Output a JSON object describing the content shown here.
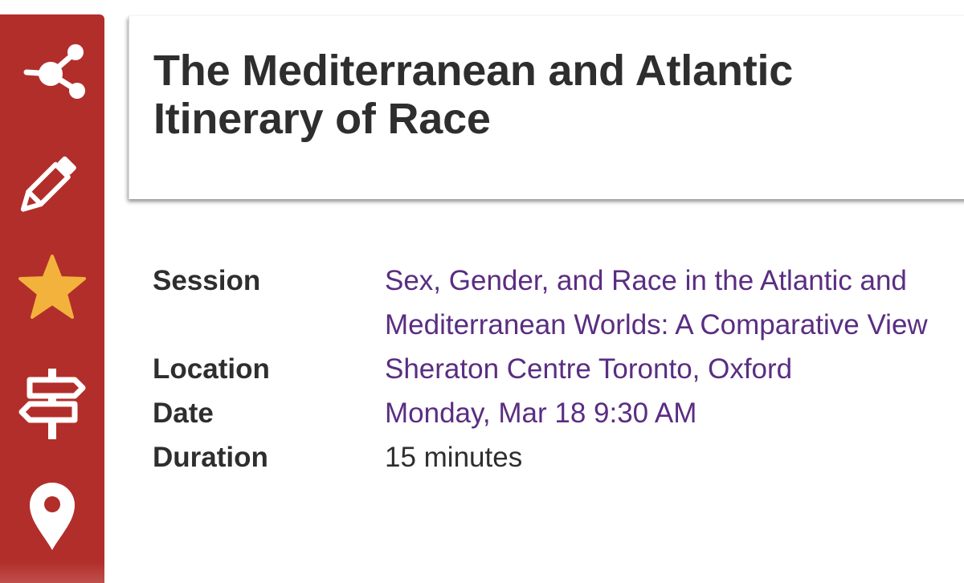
{
  "toolbar": {
    "items": [
      {
        "name": "share",
        "icon": "share-icon"
      },
      {
        "name": "edit",
        "icon": "pencil-icon"
      },
      {
        "name": "favorite",
        "icon": "star-icon"
      },
      {
        "name": "directions",
        "icon": "signpost-icon"
      },
      {
        "name": "location",
        "icon": "map-pin-icon"
      }
    ],
    "color": "#b22e2b",
    "star_color": "#f3b23c"
  },
  "event": {
    "title": "The Mediterranean and Atlantic Itinerary of Race"
  },
  "details": {
    "session_label": "Session",
    "session_value": "Sex, Gender, and Race in the Atlantic and Mediterranean Worlds: A Comparative View",
    "location_label": "Location",
    "location_value": "Sheraton Centre Toronto, Oxford",
    "date_label": "Date",
    "date_value": "Monday, Mar 18 9:30 AM",
    "duration_label": "Duration",
    "duration_value": "15 minutes"
  },
  "colors": {
    "link": "#5a2d82",
    "text": "#2e2e2e"
  }
}
